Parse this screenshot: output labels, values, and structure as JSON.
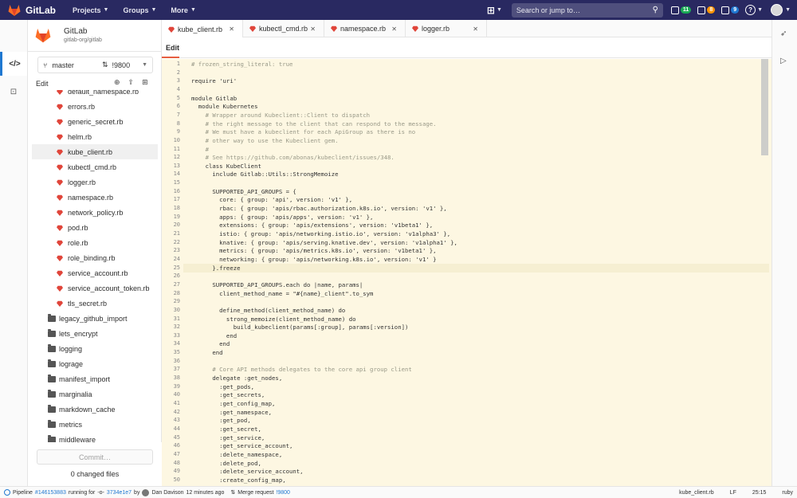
{
  "navbar": {
    "brand": "GitLab",
    "links": [
      "Projects",
      "Groups",
      "More"
    ],
    "search_placeholder": "Search or jump to…",
    "counters": [
      {
        "value": "11",
        "color": "#1aaa55"
      },
      {
        "value": "8",
        "color": "#fc9403"
      },
      {
        "value": "9",
        "color": "#1f78d1"
      }
    ]
  },
  "sidebar": {
    "project_name": "GitLab",
    "project_path": "gitlab-org/gitlab",
    "branch": "master",
    "merge_request": "!9800",
    "edit_label": "Edit",
    "commit_label": "Commit…",
    "changed_files": "0 changed files",
    "tree": [
      {
        "name": "default_namespace.rb",
        "type": "file"
      },
      {
        "name": "errors.rb",
        "type": "file"
      },
      {
        "name": "generic_secret.rb",
        "type": "file"
      },
      {
        "name": "helm.rb",
        "type": "file"
      },
      {
        "name": "kube_client.rb",
        "type": "file",
        "selected": true
      },
      {
        "name": "kubectl_cmd.rb",
        "type": "file"
      },
      {
        "name": "logger.rb",
        "type": "file"
      },
      {
        "name": "namespace.rb",
        "type": "file"
      },
      {
        "name": "network_policy.rb",
        "type": "file"
      },
      {
        "name": "pod.rb",
        "type": "file"
      },
      {
        "name": "role.rb",
        "type": "file"
      },
      {
        "name": "role_binding.rb",
        "type": "file"
      },
      {
        "name": "service_account.rb",
        "type": "file"
      },
      {
        "name": "service_account_token.rb",
        "type": "file"
      },
      {
        "name": "tls_secret.rb",
        "type": "file"
      },
      {
        "name": "legacy_github_import",
        "type": "folder"
      },
      {
        "name": "lets_encrypt",
        "type": "folder"
      },
      {
        "name": "logging",
        "type": "folder"
      },
      {
        "name": "lograge",
        "type": "folder"
      },
      {
        "name": "manifest_import",
        "type": "folder"
      },
      {
        "name": "marginalia",
        "type": "folder"
      },
      {
        "name": "markdown_cache",
        "type": "folder"
      },
      {
        "name": "metrics",
        "type": "folder"
      },
      {
        "name": "middleware",
        "type": "folder"
      }
    ]
  },
  "tabs": [
    {
      "label": "kube_client.rb",
      "active": true
    },
    {
      "label": "kubectl_cmd.rb",
      "active": false
    },
    {
      "label": "namespace.rb",
      "active": false
    },
    {
      "label": "logger.rb",
      "active": false
    }
  ],
  "editor": {
    "mode_label": "Edit",
    "cursor_line": 25,
    "lines": [
      "# frozen_string_literal: true",
      "",
      "require 'uri'",
      "",
      "module Gitlab",
      "  module Kubernetes",
      "    # Wrapper around Kubeclient::Client to dispatch",
      "    # the right message to the client that can respond to the message.",
      "    # We must have a kubeclient for each ApiGroup as there is no",
      "    # other way to use the Kubeclient gem.",
      "    #",
      "    # See https://github.com/abonas/kubeclient/issues/348.",
      "    class KubeClient",
      "      include Gitlab::Utils::StrongMemoize",
      "",
      "      SUPPORTED_API_GROUPS = {",
      "        core: { group: 'api', version: 'v1' },",
      "        rbac: { group: 'apis/rbac.authorization.k8s.io', version: 'v1' },",
      "        apps: { group: 'apis/apps', version: 'v1' },",
      "        extensions: { group: 'apis/extensions', version: 'v1beta1' },",
      "        istio: { group: 'apis/networking.istio.io', version: 'v1alpha3' },",
      "        knative: { group: 'apis/serving.knative.dev', version: 'v1alpha1' },",
      "        metrics: { group: 'apis/metrics.k8s.io', version: 'v1beta1' },",
      "        networking: { group: 'apis/networking.k8s.io', version: 'v1' }",
      "      }.freeze",
      "",
      "      SUPPORTED_API_GROUPS.each do |name, params|",
      "        client_method_name = \"#{name}_client\".to_sym",
      "",
      "        define_method(client_method_name) do",
      "          strong_memoize(client_method_name) do",
      "            build_kubeclient(params[:group], params[:version])",
      "          end",
      "        end",
      "      end",
      "",
      "      # Core API methods delegates to the core api group client",
      "      delegate :get_nodes,",
      "        :get_pods,",
      "        :get_secrets,",
      "        :get_config_map,",
      "        :get_namespace,",
      "        :get_pod,",
      "        :get_secret,",
      "        :get_service,",
      "        :get_service_account,",
      "        :delete_namespace,",
      "        :delete_pod,",
      "        :delete_service_account,",
      "        :create_config_map,"
    ]
  },
  "statusbar": {
    "pipeline_prefix": "Pipeline",
    "pipeline_id": "#146153883",
    "pipeline_status": "running for",
    "commit": "3734e1e7",
    "by": "by",
    "author": "Dan Davison",
    "time": "12 minutes ago",
    "mr_prefix": "Merge request",
    "mr_id": "!9800",
    "file": "kube_client.rb",
    "eol": "LF",
    "cursor": "25:15",
    "language": "ruby"
  }
}
